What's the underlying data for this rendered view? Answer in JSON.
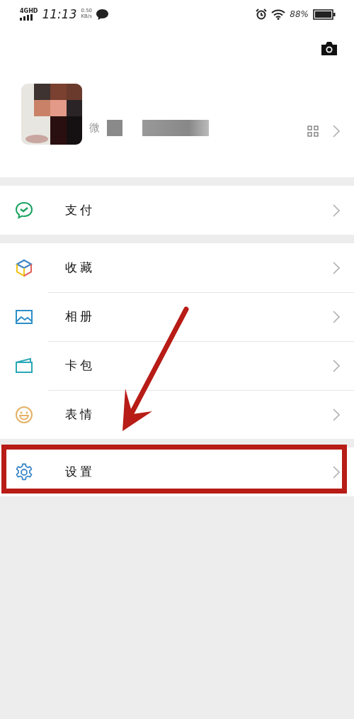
{
  "status_bar": {
    "network": "4GHD",
    "time": "11:13",
    "speed": "0.50",
    "speed_unit": "KB/s",
    "battery": "88%"
  },
  "profile": {
    "id_label": "微"
  },
  "menu_groups": [
    {
      "items": [
        {
          "label": "支付",
          "kind": "pay",
          "highlighted": false
        }
      ]
    },
    {
      "items": [
        {
          "label": "收藏",
          "kind": "favorites",
          "highlighted": false
        },
        {
          "label": "相册",
          "kind": "album",
          "highlighted": false
        },
        {
          "label": "卡包",
          "kind": "cards",
          "highlighted": false
        },
        {
          "label": "表情",
          "kind": "stickers",
          "highlighted": false
        }
      ]
    },
    {
      "items": [
        {
          "label": "设置",
          "kind": "settings",
          "highlighted": true
        }
      ]
    }
  ]
}
